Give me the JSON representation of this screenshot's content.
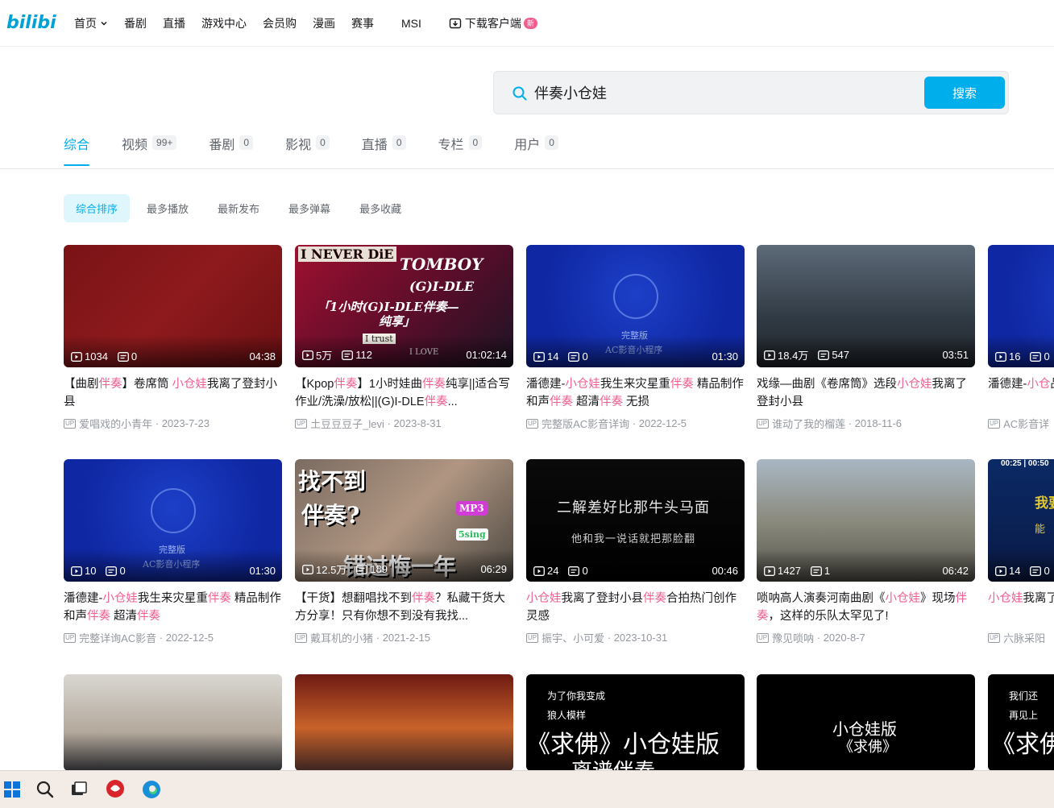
{
  "logo": "bilibili",
  "nav": {
    "items": [
      "首页",
      "番剧",
      "直播",
      "游戏中心",
      "会员购",
      "漫画",
      "赛事",
      "MSI"
    ],
    "download": "下载客户端",
    "download_badge": "新"
  },
  "search": {
    "query": "伴奏小仓娃",
    "button": "搜索"
  },
  "tabs": [
    {
      "label": "综合",
      "count": ""
    },
    {
      "label": "视频",
      "count": "99+"
    },
    {
      "label": "番剧",
      "count": "0"
    },
    {
      "label": "影视",
      "count": "0"
    },
    {
      "label": "直播",
      "count": "0"
    },
    {
      "label": "专栏",
      "count": "0"
    },
    {
      "label": "用户",
      "count": "0"
    }
  ],
  "sort": [
    "综合排序",
    "最多播放",
    "最新发布",
    "最多弹幕",
    "最多收藏"
  ],
  "videos": [
    {
      "plays": "1034",
      "danmaku": "0",
      "duration": "04:38",
      "title_parts": [
        "【曲剧",
        "伴奏",
        "】卷席筒 ",
        "小仓娃",
        "我离了登封小县"
      ],
      "author": "爱唱戏的小青年",
      "date": "2023-7-23"
    },
    {
      "plays": "5万",
      "danmaku": "112",
      "duration": "01:02:14",
      "title_parts": [
        "【Kpop",
        "伴奏",
        "】1小时娃曲",
        "伴奏",
        "纯享||适合写作业/洗澡/放松||(G)I-DLE",
        "伴奏",
        "..."
      ],
      "author": "土豆豆豆子_levi",
      "date": "2023-8-31",
      "thumb_text": [
        "I NEVER DiE",
        "TOMBOY",
        "(G)I-DLE",
        "「1小时(G)I-DLE伴奏—",
        "纯享」",
        "I trust",
        "I LOVE"
      ]
    },
    {
      "plays": "14",
      "danmaku": "0",
      "duration": "01:30",
      "title_parts": [
        "潘德建-",
        "小仓娃",
        "我生来灾星重",
        "伴奏",
        " 精品制作和声",
        "伴奏",
        " 超清",
        "伴奏",
        " 无损"
      ],
      "author": "完整版AC影音详询",
      "date": "2022-12-5",
      "thumb_text": [
        "完整版",
        "AC影音小程序"
      ]
    },
    {
      "plays": "18.4万",
      "danmaku": "547",
      "duration": "03:51",
      "title_parts": [
        "戏缘—曲剧《卷席筒》选段",
        "小仓娃",
        "我离了登封小县"
      ],
      "author": "谁动了我的榴莲",
      "date": "2018-11-6"
    },
    {
      "plays": "16",
      "danmaku": "0",
      "duration": "",
      "title_parts": [
        "潘德建-",
        "小仓",
        "品制作纯",
        "伴"
      ],
      "author": "AC影音详",
      "date": ""
    },
    {
      "plays": "10",
      "danmaku": "0",
      "duration": "01:30",
      "title_parts": [
        "潘德建-",
        "小仓娃",
        "我生来灾星重",
        "伴奏",
        " 精品制作和声",
        "伴奏",
        " 超清",
        "伴奏"
      ],
      "author": "完整详询AC影音",
      "date": "2022-12-5",
      "thumb_text": [
        "完整版",
        "AC影音小程序"
      ]
    },
    {
      "plays": "12.5万",
      "danmaku": "189",
      "duration": "06:29",
      "title_parts": [
        "【干货】想翻唱找不到",
        "伴奏",
        "？私藏干货大方分享！只有你想不到没有我找..."
      ],
      "author": "戴耳机的小猪",
      "date": "2021-2-15",
      "thumb_text": [
        "找不到",
        "伴奏?",
        "错过悔一年",
        "MP3",
        "5sing"
      ]
    },
    {
      "plays": "24",
      "danmaku": "0",
      "duration": "00:46",
      "title_parts": [
        "",
        "小仓娃",
        "我离了登封小县",
        "伴奏",
        "合拍热门创作灵感"
      ],
      "author": "振宇、小可爱",
      "date": "2023-10-31",
      "thumb_text": [
        "二解差好比那牛头马面",
        "他和我一说话就把那脸翻"
      ]
    },
    {
      "plays": "1427",
      "danmaku": "1",
      "duration": "06:42",
      "title_parts": [
        "唢呐高人演奏河南曲剧《",
        "小仓娃",
        "》现场",
        "伴奏",
        "，这样的乐队太罕见了!"
      ],
      "author": "豫见唢呐",
      "date": "2020-8-7"
    },
    {
      "plays": "14",
      "danmaku": "0",
      "duration": "",
      "title_parts": [
        "",
        "小仓娃",
        "我离了",
        "段",
        "伴奏",
        "来啦"
      ],
      "author": "六脉采阳",
      "date": "",
      "thumb_text": [
        "00:25 | 00:50",
        "我要",
        "能"
      ]
    },
    {
      "thumb_text": []
    },
    {
      "thumb_text": []
    },
    {
      "thumb_text": [
        "为了你我变成",
        "狼人模样",
        "《求佛》小仓娃版",
        "离谱伴奏"
      ]
    },
    {
      "thumb_text": [
        "小仓娃版",
        "《求佛》"
      ]
    },
    {
      "thumb_text": [
        "我们还",
        "再见上",
        "《求佛"
      ]
    }
  ],
  "colors": {
    "accent": "#00aeec",
    "highlight": "#f25d8e",
    "pink_logo": "#00a1d6"
  }
}
